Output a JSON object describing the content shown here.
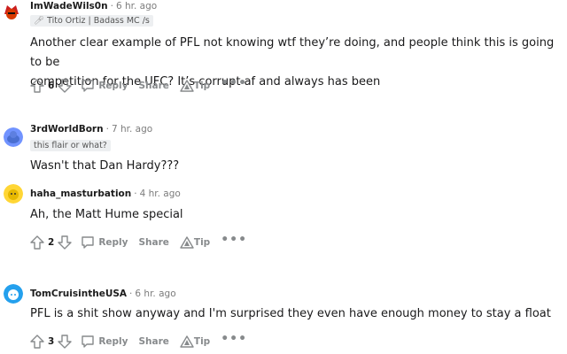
{
  "comments": [
    {
      "username": "ImWadeWils0n",
      "time": "6 hr. ago",
      "flair": "Tito Ortiz | Badass MC /s",
      "flair_icon": "microphone-icon",
      "body": [
        "Another clear example of PFL not knowing wtf they’re doing, and people think this is going to be",
        "competition for the UFC? It’s corrupt af and always has been"
      ],
      "votes": "6",
      "avatar_color": "#d93a00"
    },
    {
      "username": "3rdWorldBorn",
      "time": "7 hr. ago",
      "flair": "this flair or what?",
      "body": [
        "Wasn't that Dan Hardy???"
      ],
      "avatar_color": "#7193ff"
    },
    {
      "username": "haha_masturbation",
      "time": "4 hr. ago",
      "body": [
        "Ah, the Matt Hume special"
      ],
      "votes": "2",
      "avatar_color": "#ffd635"
    },
    {
      "username": "TomCruisintheUSA",
      "time": "6 hr. ago",
      "body": [
        "PFL is a shit show anyway and I'm surprised they even have enough money to stay a float"
      ],
      "votes": "3",
      "avatar_color": "#24a0ed"
    }
  ],
  "actions": {
    "reply": "Reply",
    "share": "Share",
    "tip": "Tip",
    "more": "•••"
  },
  "separator": "·"
}
